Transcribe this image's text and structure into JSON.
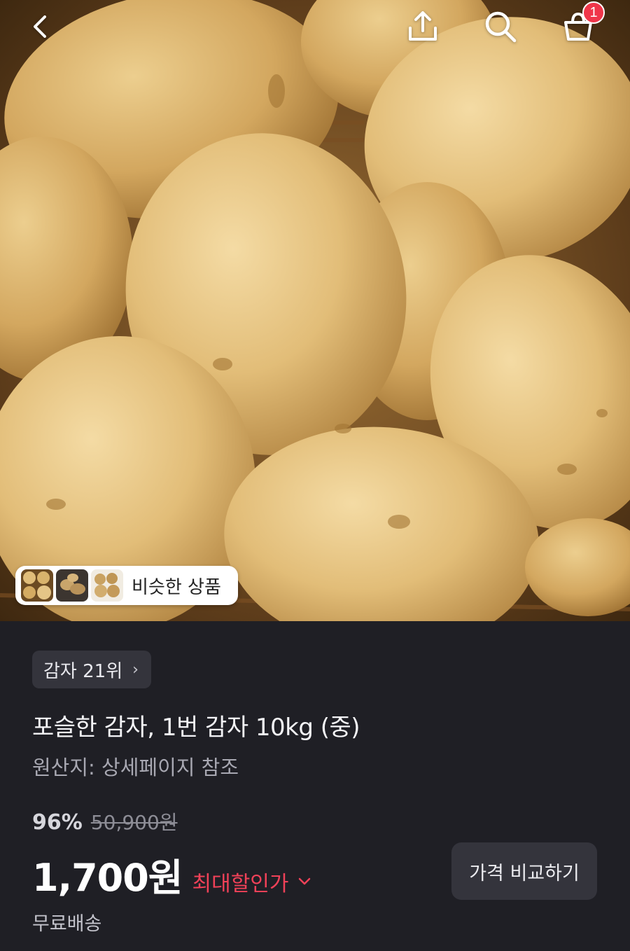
{
  "header": {
    "back_icon": "chevron-left-icon",
    "share_icon": "share-upload-icon",
    "search_icon": "search-icon",
    "cart_icon": "shopping-bag-icon",
    "cart_badge": "1",
    "badge_color": "#f0364a"
  },
  "hero": {
    "image": "potatoes-in-basket-photo",
    "similar_products_label": "비슷한 상품"
  },
  "product": {
    "rank_label": "감자 21위",
    "title": "포슬한 감자, 1번 감자 10kg (중)",
    "origin": "원산지: 상세페이지 참조",
    "discount_rate": "96%",
    "original_price": "50,900원",
    "price": "1,700원",
    "max_discount_label": "최대할인가",
    "compare_button": "가격 비교하기",
    "shipping": "무료배송"
  },
  "colors": {
    "background": "#1f1f25",
    "chip_background": "#34343c",
    "accent_red": "#f04158"
  }
}
